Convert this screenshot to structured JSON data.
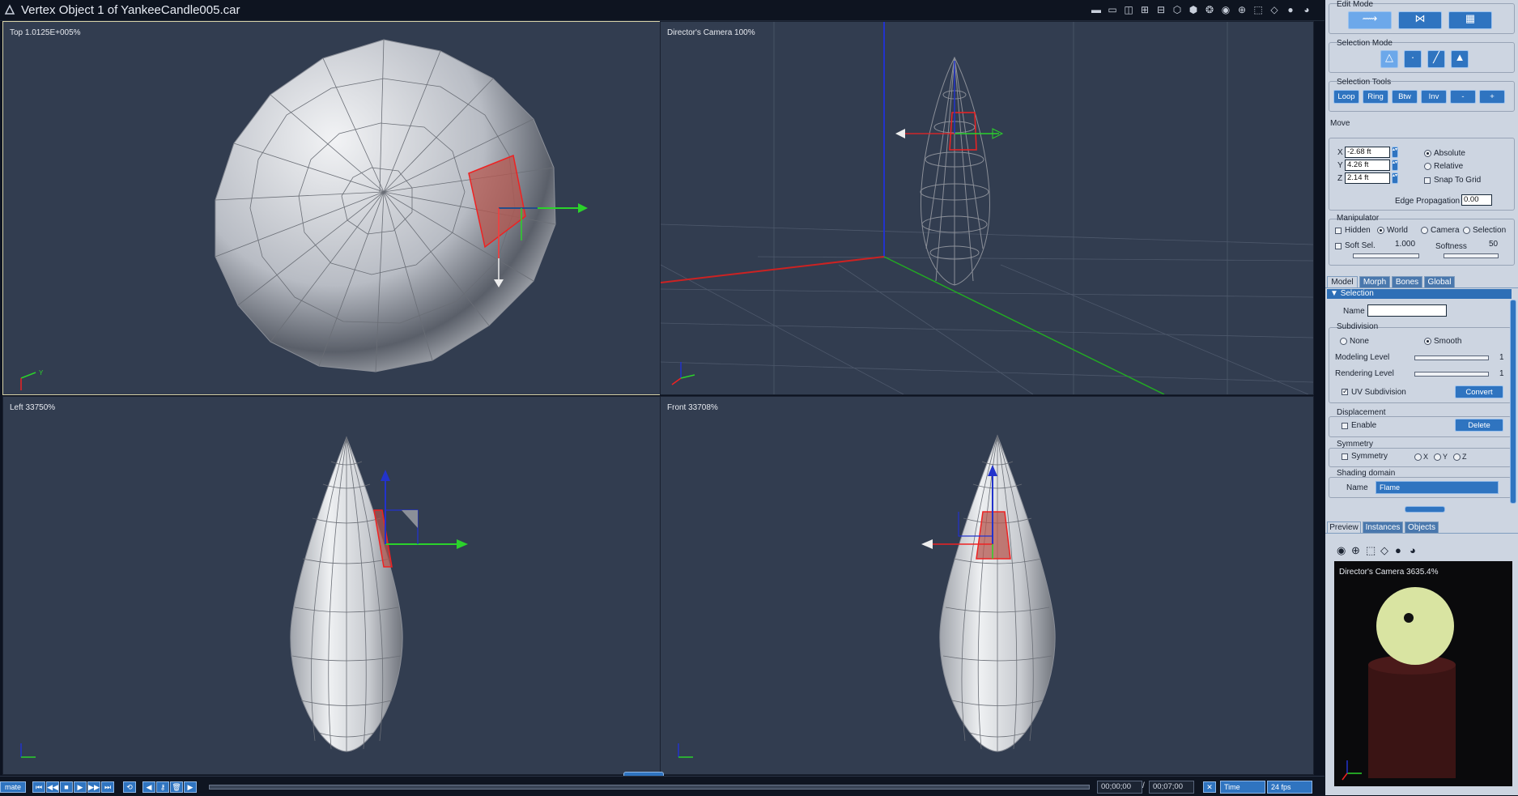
{
  "window": {
    "title": "Vertex Object 1 of YankeeCandle005.car"
  },
  "viewports": {
    "top": {
      "label": "Top 1.0125E+005%"
    },
    "camera": {
      "label": "Director's Camera 100%"
    },
    "left": {
      "label": "Left 33750%"
    },
    "front": {
      "label": "Front 33708%"
    }
  },
  "axis_labels": {
    "y": "Y",
    "z": "Z"
  },
  "timeline": {
    "left_label": "mate",
    "current_time": "00;00;00",
    "separator": "/",
    "end_time": "00;07;00",
    "mode": "Time",
    "fps": "24 fps"
  },
  "panel": {
    "edit_mode": {
      "title": "Edit Mode"
    },
    "selection_mode": {
      "title": "Selection Mode"
    },
    "selection_tools": {
      "title": "Selection Tools",
      "buttons": [
        "Loop",
        "Ring",
        "Btw",
        "Inv",
        "-",
        "+"
      ]
    },
    "move": {
      "title": "Move",
      "x_label": "X",
      "x_value": "-2.68 ft",
      "y_label": "Y",
      "y_value": "4.26 ft",
      "z_label": "Z",
      "z_value": "2.14 ft",
      "absolute": "Absolute",
      "relative": "Relative",
      "snap": "Snap To Grid",
      "edge_prop_label": "Edge Propagation",
      "edge_prop_value": "0.00"
    },
    "manipulator": {
      "title": "Manipulator",
      "hidden": "Hidden",
      "world": "World",
      "camera": "Camera",
      "selection": "Selection",
      "soft_sel": "Soft Sel.",
      "soft_sel_value": "1.000",
      "softness": "Softness",
      "softness_value": "50"
    },
    "tabs": [
      "Model",
      "Morph",
      "Bones",
      "Global"
    ],
    "selection_section": {
      "title": "Selection",
      "name_label": "Name",
      "name_value": ""
    },
    "subdivision": {
      "title": "Subdivision",
      "none": "None",
      "smooth": "Smooth",
      "modeling_level": "Modeling Level",
      "modeling_value": "1",
      "rendering_level": "Rendering Level",
      "rendering_value": "1",
      "uv": "UV Subdivision",
      "convert": "Convert"
    },
    "displacement": {
      "title": "Displacement",
      "enable": "Enable",
      "delete": "Delete"
    },
    "symmetry": {
      "title": "Symmetry",
      "symmetry": "Symmetry",
      "x": "X",
      "y": "Y",
      "z": "Z"
    },
    "shading_domain": {
      "title": "Shading domain",
      "name_label": "Name",
      "name_value": "Flame"
    },
    "bottom_tabs": [
      "Preview",
      "Instances",
      "Objects"
    ],
    "preview_label": "Director's Camera 3635.4%"
  }
}
